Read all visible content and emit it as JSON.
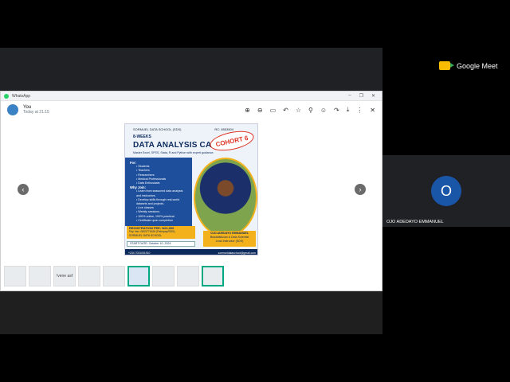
{
  "meet": {
    "brand": "Google Meet",
    "accent": "#fbbc04"
  },
  "window": {
    "title": "WhatsApp",
    "controls": [
      "–",
      "❐",
      "✕"
    ]
  },
  "viewer": {
    "sender_name": "You",
    "sent_time": "Today at 21:15",
    "tools": [
      "zoom-in-icon",
      "zoom-out-icon",
      "comment-icon",
      "reply-icon",
      "star-icon",
      "pin-icon",
      "emoji-icon",
      "forward-icon",
      "download-icon",
      "more-icon",
      "close-icon"
    ]
  },
  "poster": {
    "school": "SORMUEL DATA SCHOOL (SDS)",
    "rc": "RC: 8553504",
    "weeks": "8-WEEKS",
    "title": "DATA ANALYSIS CAMP",
    "subtitle": "Master Excel, SPSS, Stata, R  and Python with expert guidance.",
    "cohort": "COHORT 6",
    "for_heading": "For:",
    "audience": [
      "Students",
      "Teachers",
      "Researchers",
      "Medical Professionals",
      "Data Enthusiasts"
    ],
    "why_heading": "Why Join:",
    "reasons": [
      "Learn from seasoned data analysts and instructors.",
      "Develop skills through real-world datasets and projects.",
      "Live classes",
      "Weekly sessions.",
      "100% online, 100% practical",
      "Certificate upon completion"
    ],
    "registration_fee": "REGISTRATION FEE: N20,000",
    "account_line1": "Pay Into: 0603771626 (Palmpay/SDS)",
    "account_line2": "SORMUEL DATA SCHOOL",
    "start_date": "START DATE: October 10, 2024",
    "instructor_name": "OJO ADEDAYO EMMANUEL",
    "instructor_title": "Biostatistician & Data Scientist",
    "instructor_role": "Lead Instructor (SDS)",
    "phone": "+234 7031031910",
    "email": "sormueldataschool@gmail.com"
  },
  "thumbnails": [
    "",
    "",
    "!vene asf",
    "",
    "",
    "",
    "",
    "",
    ""
  ],
  "participant": {
    "initial": "O",
    "name": "OJO ADEDAYO EMMANUEL",
    "color": "#1a56a8"
  }
}
